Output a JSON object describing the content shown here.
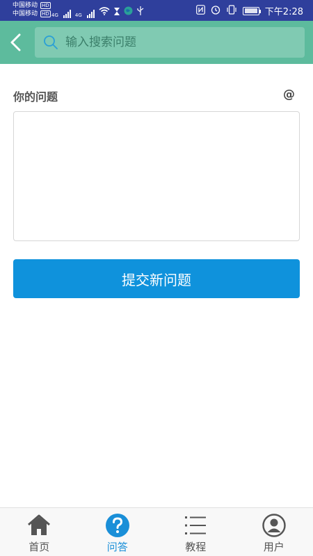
{
  "status_bar": {
    "carrier1": "中国移动",
    "carrier2": "中国移动",
    "hd": "HD",
    "net1": "4G",
    "net2": "4G",
    "time": "下午2:28",
    "icon_names": [
      "wifi-icon",
      "hourglass-icon",
      "globe-icon",
      "usb-icon",
      "nfc-icon",
      "alarm-icon",
      "vibrate-icon",
      "battery-icon"
    ]
  },
  "header": {
    "search_placeholder": "输入搜索问题"
  },
  "form": {
    "label": "你的问题",
    "at_label": "@",
    "textarea_value": "",
    "submit_label": "提交新问题"
  },
  "bottom_nav": {
    "items": [
      {
        "label": "首页",
        "icon": "home-icon"
      },
      {
        "label": "问答",
        "icon": "question-icon",
        "active": true
      },
      {
        "label": "教程",
        "icon": "list-icon"
      },
      {
        "label": "用户",
        "icon": "user-icon"
      }
    ]
  },
  "colors": {
    "status_bar": "#2f3f9c",
    "header": "#5dbb9d",
    "primary": "#0f92dc",
    "active_nav": "#1a8fd8"
  }
}
